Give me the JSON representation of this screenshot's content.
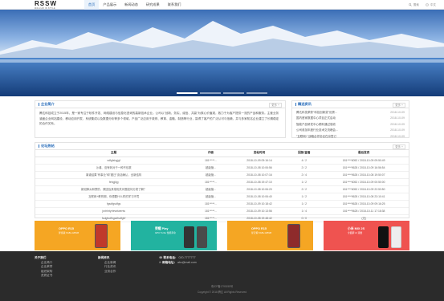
{
  "header": {
    "logo": "RSSW",
    "logo_sub": "WALLUM IN STYLE",
    "nav": [
      "首页",
      "产品展示",
      "新闻动态",
      "研究成果",
      "联系我们"
    ],
    "search": "搜索",
    "lang": "中文"
  },
  "banner": {
    "slides": 4,
    "active": 0
  },
  "about": {
    "title": "企业简介",
    "more": "更多 +",
    "text": "腾达科技成立于2015年，是一家专注于软件开发、网络建设与信息化咨询的高新技术企业。公司以\"创新、务实、诚信、共赢\"为核心价值观，致力于为客户提供一流的产品和服务。主营业务涵盖企业网站建设、移动应用开发、系统集成以及数据分析等多个领域，产品广泛应用于政府、教育、金融、制造等行业，赢得了客户的广泛认可与信赖，并与多家知名企业建立了长期稳定的合作关系。"
  },
  "news": {
    "title": "精选资讯",
    "more": "更多 +",
    "items": [
      {
        "title": "腾达科技荣获\"科技创新奖\"优秀...",
        "date": "2018-10-09"
      },
      {
        "title": "国内首家数据中心项目正式启动",
        "date": "2018-10-09"
      },
      {
        "title": "智能产品研发中心顺利通过验收",
        "date": "2018-10-09"
      },
      {
        "title": "公司参加年度行业技术交流峰会...",
        "date": "2018-10-09"
      },
      {
        "title": "\"互联网+\"战略合作协议在京签订",
        "date": "2018-10-09"
      },
      {
        "title": "新产品发布会圆满举行",
        "date": "2018-10-09"
      }
    ]
  },
  "forum": {
    "title": "论坛热帖",
    "more": "更多 +",
    "columns": [
      "主题",
      "作者",
      "发帖时间",
      "回复/查看",
      "最后发表"
    ],
    "rows": [
      [
        "sdfgfshgjgf",
        "181*****...",
        "2018-10-09 09:16:14",
        "4 / 2",
        "181****6052 / 2018-10-09 09:50:49"
      ],
      [
        "沙滩、没有刺对于一种不包裹",
        "超级管...",
        "2018-10-08 10:06:56",
        "2 / 2",
        "181****9628 / 2018-10-09 16:56:54"
      ],
      [
        "离谱结果\"有事业\"和\"搬迁\"谈话确认，全新结构",
        "超级管...",
        "2018-10-08 10:07:16",
        "2 / 4",
        "181****9628 / 2018-10-08 19:50:07"
      ],
      [
        "fehgjkjg",
        "181*****...",
        "2018-10-08 19:47:10",
        "1 / 2",
        "181****6052 / 2018-10-09 00:50:00"
      ],
      [
        "新冠肺炎和预防，原因及其他相关问题如何分类了解？",
        "超级管...",
        "2018-10-08 10:06:20",
        "2 / 2",
        "181****6052 / 2018-10-09 22:53:50"
      ],
      [
        "互联网+教育期，你想要什么样的学习环境",
        "超级管...",
        "2018-10-08 10:06:40",
        "1 / 2",
        "181****9628 / 2018-10-08 23:10:41"
      ],
      [
        "fgsdfgsdfgs",
        "181*****...",
        "2018-10-09 10:18:42",
        "1 / 2",
        "181****9628 / 2018-10-09 09:16:25"
      ],
      [
        "jsrtrhrtyrtewrtwertw",
        "181*****...",
        "2018-10-09 10:13:56",
        "1 / 4",
        "181****9628 / 2018-10-11 17:18:38"
      ],
      [
        "fsdgfsdfhgsdfsdfghf",
        "181*****...",
        "2018-10-08 19:48:42",
        "0 / 0",
        "(无)"
      ]
    ]
  },
  "cards": [
    {
      "line1": "OPPO R15",
      "line2": "梦境版 6GB+128GB",
      "color": "#f5a623"
    },
    {
      "line1": "荣耀 Play",
      "line2": "GPU Turbo 性能革命",
      "color": "#22b3a0"
    },
    {
      "line1": "OPPO R15",
      "line2": "星空紫 6GB+128GB",
      "color": "#f5a623"
    },
    {
      "line1": "小米 MIX 2S",
      "line2": "全面屏 AI 双摄",
      "color": "#ef5350"
    }
  ],
  "footer": {
    "col1": {
      "head": "关于我们",
      "items": [
        "企业简介",
        "企业荣誉",
        "组织架构",
        "资质证书"
      ]
    },
    "col2": {
      "head": "新闻资讯",
      "items": [
        "企业新闻",
        "行业资讯",
        "业务合作"
      ]
    },
    "col3": {
      "phone_label": "联系电话：",
      "phone": "020-7777777",
      "email_label": "邮箱地址：",
      "email": "abc@mail.com"
    },
    "icp": "粤ICP备1790155号",
    "copyright": "Copyright © 2018 腾达 All Rights Reserved"
  }
}
